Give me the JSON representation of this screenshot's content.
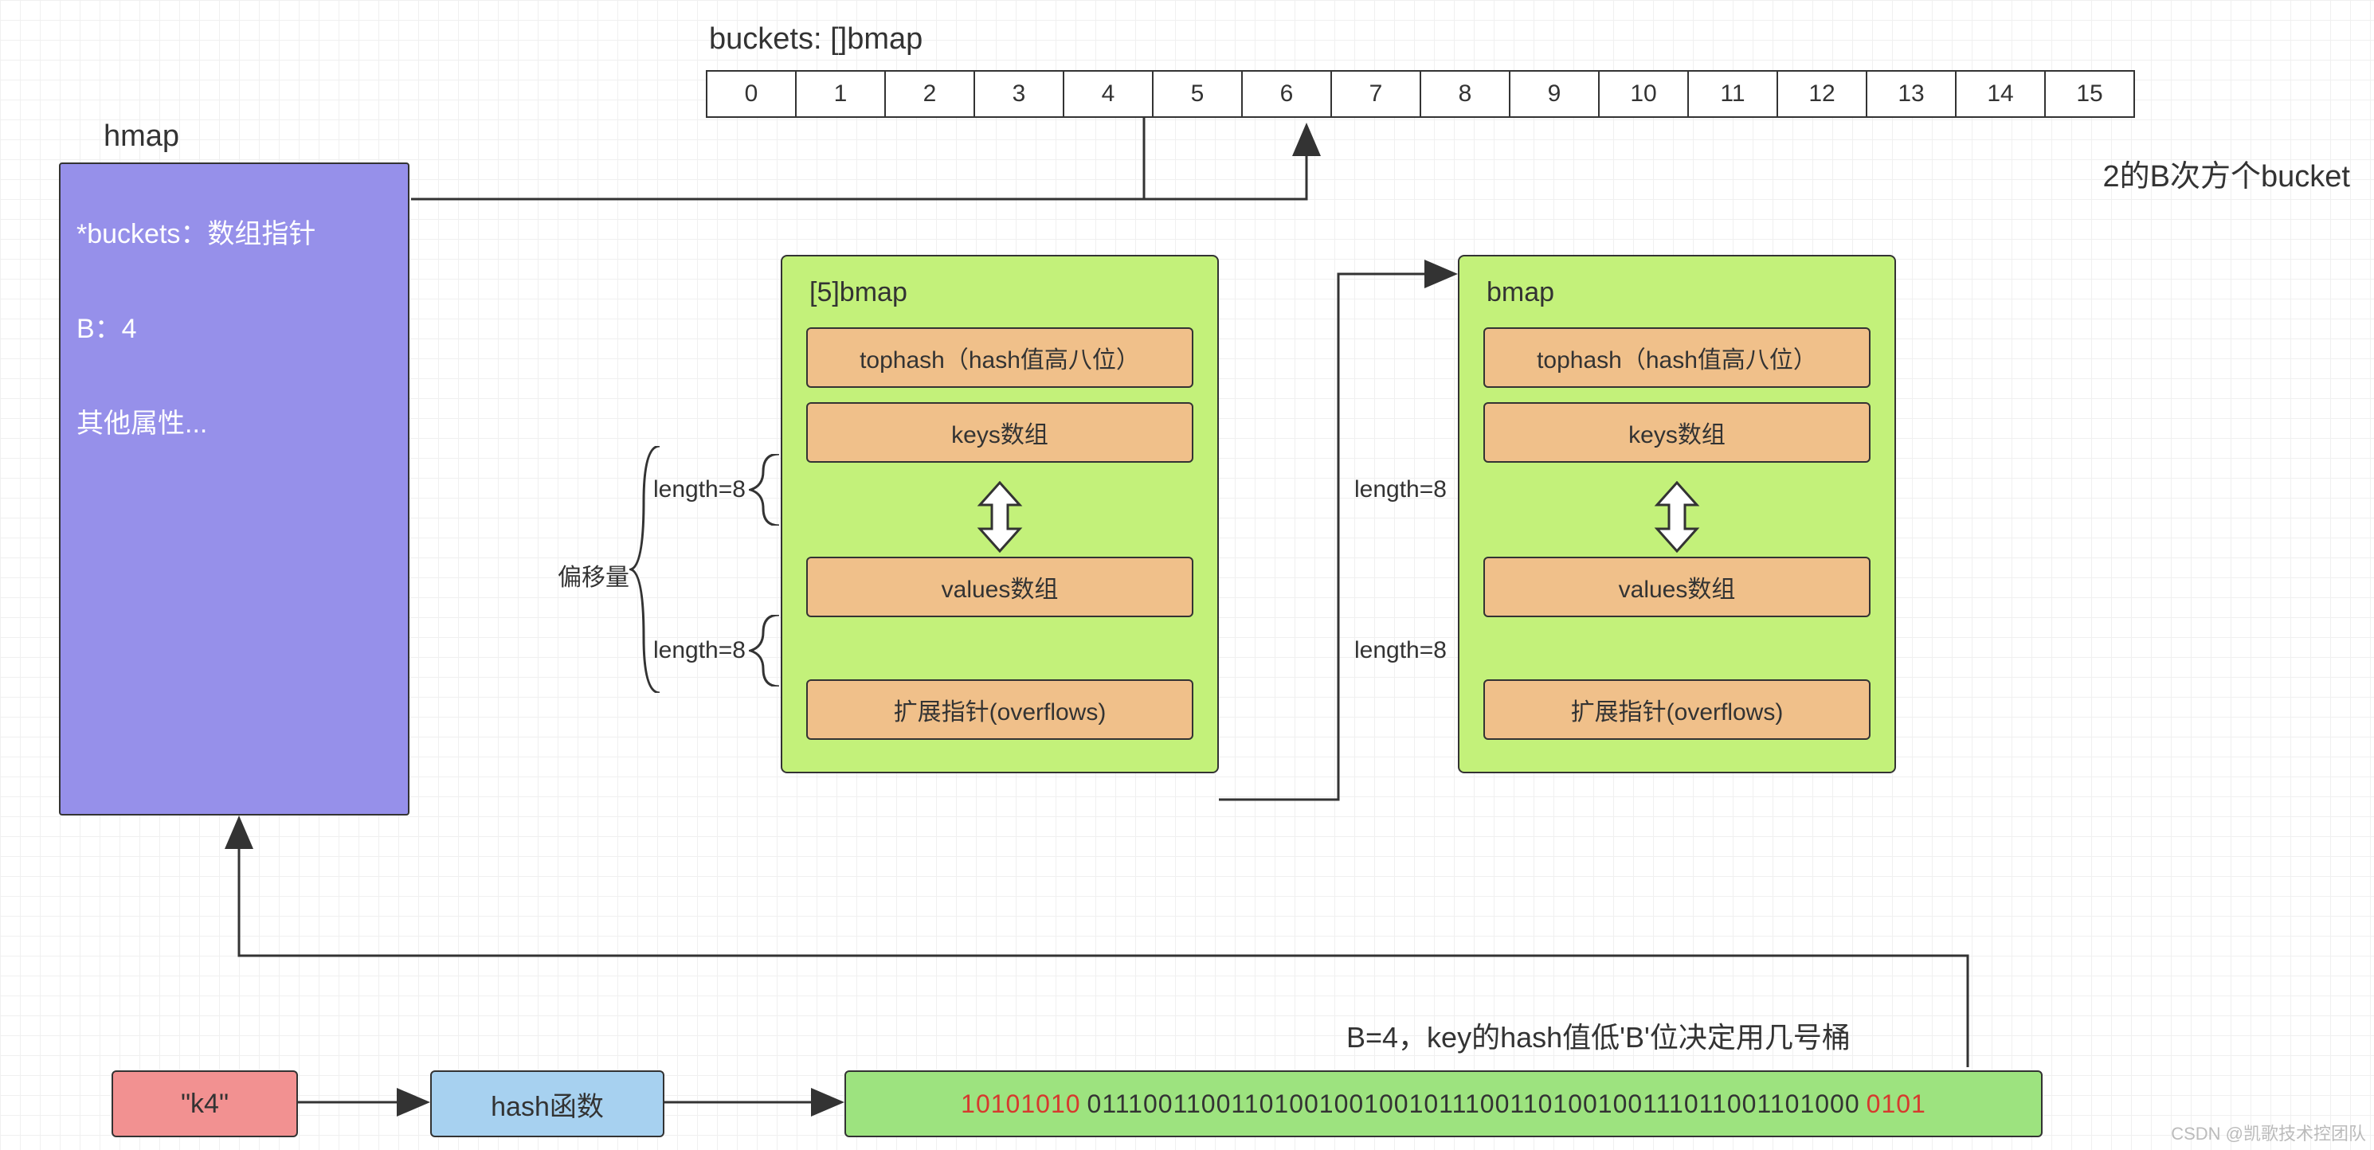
{
  "hmap": {
    "title": "hmap",
    "buckets_ptr": "*buckets：数组指针",
    "b_value": "B：4",
    "other": "其他属性..."
  },
  "buckets_label": "buckets: []bmap",
  "buckets_count_note": "2的B次方个bucket",
  "buckets_cells": [
    "0",
    "1",
    "2",
    "3",
    "4",
    "5",
    "6",
    "7",
    "8",
    "9",
    "10",
    "11",
    "12",
    "13",
    "14",
    "15"
  ],
  "bmap_left": {
    "title": "[5]bmap",
    "tophash": "tophash（hash值高八位）",
    "keys": "keys数组",
    "values": "values数组",
    "overflow": "扩展指针(overflows)",
    "len_keys": "length=8",
    "len_values": "length=8",
    "offset_label": "偏移量"
  },
  "bmap_right": {
    "title": "bmap",
    "tophash": "tophash（hash值高八位）",
    "keys": "keys数组",
    "values": "values数组",
    "overflow": "扩展指针(overflows)",
    "len_keys": "length=8",
    "len_values": "length=8"
  },
  "bottom": {
    "key_literal": "\"k4\"",
    "hash_fn": "hash函数",
    "b_rule": "B=4，key的hash值低'B'位决定用几号桶",
    "hash_high": "10101010",
    "hash_mid": "01110011001101001001001011100110100100111011001101000",
    "hash_low": "0101"
  },
  "watermark": "CSDN @凯歌技术控团队"
}
